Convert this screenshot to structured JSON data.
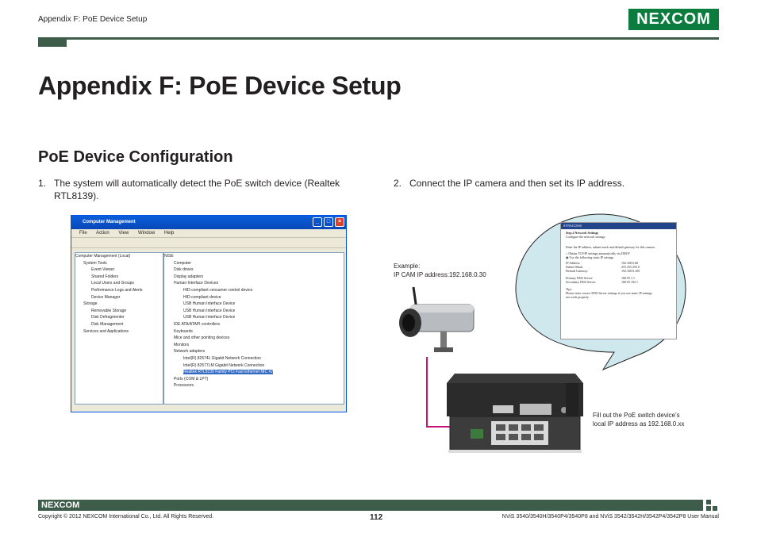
{
  "header": {
    "section": "Appendix F: PoE Device Setup",
    "logo_text": "NEXCOM"
  },
  "page": {
    "title": "Appendix F: PoE Device Setup",
    "subtitle": "PoE Device Configuration"
  },
  "steps": {
    "one_num": "1.",
    "one_text_a": "The system will automatically detect the PoE switch device (Realtek",
    "one_text_b": "RTL8139).",
    "two_num": "2.",
    "two_text": "Connect the IP camera and then set its IP address."
  },
  "window": {
    "title": "Computer Management",
    "menu": [
      "File",
      "Action",
      "View",
      "Window",
      "Help"
    ],
    "left_tree": [
      "Computer Management (Local)",
      "System Tools",
      "Event Viewer",
      "Shared Folders",
      "Local Users and Groups",
      "Performance Logs and Alerts",
      "Device Manager",
      "Storage",
      "Removable Storage",
      "Disk Defragmenter",
      "Disk Management",
      "Services and Applications"
    ],
    "right_tree": [
      "NISE",
      "Computer",
      "Disk drives",
      "Display adapters",
      "Human Interface Devices",
      "HID-compliant consumer control device",
      "HID-compliant device",
      "USB Human Interface Device",
      "USB Human Interface Device",
      "USB Human Interface Device",
      "IDE ATA/ATAPI controllers",
      "Keyboards",
      "Mice and other pointing devices",
      "Monitors",
      "Network adapters",
      "Intel(R) 82574L Gigabit Network Connection",
      "Intel(R) 82577LM Gigabit Network Connection",
      "Realtek RTL8139 Family PCI Fast Ethernet NIC #2",
      "Ports (COM & LPT)",
      "Processors"
    ]
  },
  "config_panel": {
    "brand": "SYNACCESS",
    "step": "Step 4 Network Settings",
    "step_sub": "Configure the network settings",
    "intro": "Enter the IP address, subnet mask and default gateway for this camera",
    "dhcp": "Obtain TCP/IP settings automatically via DHCP",
    "static": "Use the following static IP settings",
    "ip_label": "IP Address:",
    "ip": [
      "192",
      "168",
      "0",
      "68"
    ],
    "mask_label": "Subnet Mask:",
    "mask": [
      "255",
      "255",
      "255",
      "0"
    ],
    "gw_label": "Default Gateway:",
    "gw": [
      "192",
      "168",
      "0",
      "100"
    ],
    "dns1_label": "Primary DNS Server:",
    "dns1": [
      "168",
      "95",
      "1",
      "1"
    ],
    "dns2_label": "Secondary DNS Server:",
    "dns2": [
      "168",
      "95",
      "192",
      "1"
    ],
    "tips": "Tips:",
    "tips_text": "Please enter correct DNS Server settings if you use static IP settings",
    "tips_text2": "not work properly."
  },
  "example": {
    "label": "Example:",
    "value": "IP CAM IP address:192.168.0.30"
  },
  "fill_note": {
    "line1": "Fill out the PoE switch device’s",
    "line2": "local IP address as 192.168.0.xx"
  },
  "footer": {
    "logo_text": "NEXCOM",
    "copyright": "Copyright © 2012 NEXCOM International Co., Ltd. All Rights Reserved.",
    "page_number": "112",
    "manual": "NViS 3540/3540H/3540P4/3540P8 and NViS 3542/3542H/3542P4/3542P8 User Manual"
  },
  "colors": {
    "brand_green": "#0b7b3e",
    "bar_green": "#3d5c4a",
    "callout": "#cfe8ee",
    "connector": "#c4147a"
  }
}
